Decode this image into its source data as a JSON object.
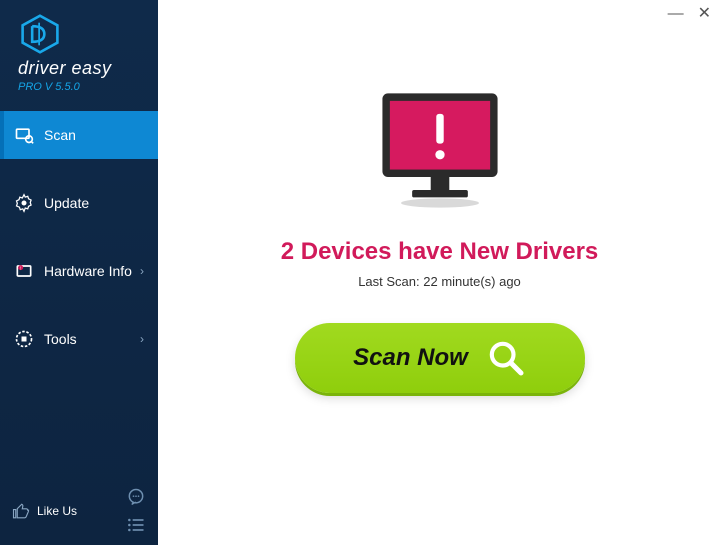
{
  "brand": {
    "name": "driver easy",
    "version": "PRO V 5.5.0"
  },
  "sidebar": {
    "items": [
      {
        "label": "Scan",
        "has_sub": false
      },
      {
        "label": "Update",
        "has_sub": false
      },
      {
        "label": "Hardware Info",
        "has_sub": true
      },
      {
        "label": "Tools",
        "has_sub": true
      }
    ],
    "like_label": "Like Us"
  },
  "main": {
    "status_title": "2 Devices have New Drivers",
    "status_sub": "Last Scan: 22 minute(s) ago",
    "scan_button": "Scan Now"
  }
}
